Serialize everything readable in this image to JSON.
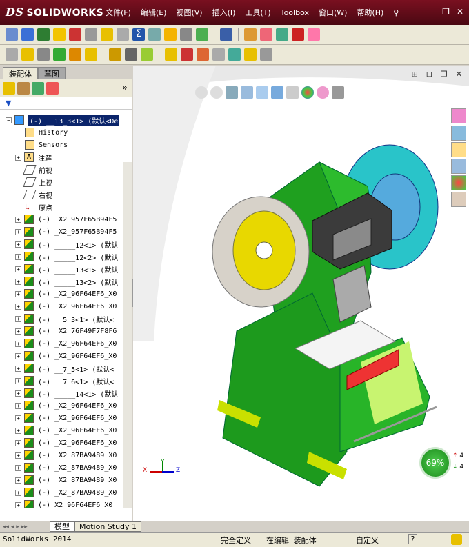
{
  "app": {
    "logo_ds": "DS",
    "logo_text": "SOLIDWORKS"
  },
  "menu": [
    "文件(F)",
    "编辑(E)",
    "视图(V)",
    "插入(I)",
    "工具(T)",
    "Toolbox",
    "窗口(W)",
    "帮助(H)"
  ],
  "window_controls": {
    "minimize": "—",
    "restore": "❐",
    "close": "✕"
  },
  "panel": {
    "tabs": [
      "装配体",
      "草图"
    ],
    "active_tab": "装配体"
  },
  "tree": {
    "root": "(-) __13_3<1> (默认<De",
    "special": [
      "History",
      "Sensors",
      "注解",
      "前视",
      "上视",
      "右视",
      "原点"
    ],
    "parts": [
      "(-) _X2_957F65B94F5",
      "(-) _X2_957F65B94F5",
      "(-) _____12<1> (默认",
      "(-) _____12<2> (默认",
      "(-) _____13<1> (默认",
      "(-) _____13<2> (默认",
      "(-) _X2_96F64EF6_X0",
      "(-) _X2_96F64EF6_X0",
      "(-) __5_3<1> (默认<",
      "(-) _X2_76F49F7F8F6",
      "(-) _X2_96F64EF6_X0",
      "(-) _X2_96F64EF6_X0",
      "(-) __7_5<1> (默认<",
      "(-) __7_6<1> (默认<",
      "(-) _____14<1> (默认",
      "(-) _X2_96F64EF6_X0",
      "(-) _X2_96F64EF6_X0",
      "(-) _X2_96F64EF6_X0",
      "(-) _X2_96F64EF6_X0",
      "(-) _X2_87BA9489_X0",
      "(-) _X2_87BA9489_X0",
      "(-) _X2_87BA9489_X0",
      "(-) _X2_87BA9489_X0",
      "(-) X2 96F64EF6 X0"
    ]
  },
  "bottom_tabs": [
    "模型",
    "Motion Study 1"
  ],
  "status": {
    "app": "SolidWorks 2014",
    "s1": "完全定义",
    "s2": "在编辑 装配体",
    "s3": "自定义",
    "s4": "?"
  },
  "gauge": {
    "percent": "69%",
    "up": "4",
    "down": "4"
  },
  "triad": {
    "x": "X",
    "y": "Y",
    "z": "Z"
  },
  "colors": {
    "machine_green": "#1f9a1f",
    "flywheel_cyan": "#29c4c9",
    "wheel_gray": "#d7d2c9",
    "yellow": "#e8d800",
    "accent_title": "#7a1020"
  }
}
